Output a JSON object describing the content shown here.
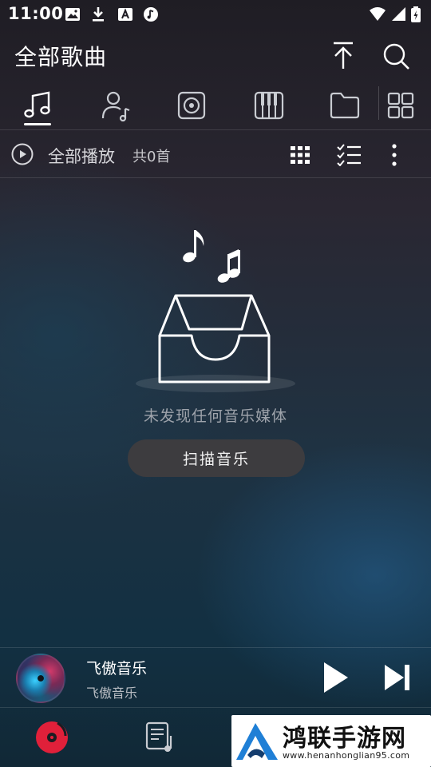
{
  "status_bar": {
    "time": "11:00"
  },
  "header": {
    "title": "全部歌曲"
  },
  "tabs": [
    {
      "name": "songs",
      "icon": "music-note-icon",
      "active": true
    },
    {
      "name": "artists",
      "icon": "artist-icon",
      "active": false
    },
    {
      "name": "albums",
      "icon": "disc-icon",
      "active": false
    },
    {
      "name": "genres",
      "icon": "piano-icon",
      "active": false
    },
    {
      "name": "folders",
      "icon": "folder-icon",
      "active": false
    },
    {
      "name": "more",
      "icon": "grid-icon",
      "active": false
    }
  ],
  "play_all": {
    "label": "全部播放",
    "count": "共0首"
  },
  "empty_state": {
    "message": "未发现任何音乐媒体",
    "scan_button": "扫描音乐"
  },
  "mini_player": {
    "title": "飞傲音乐",
    "artist": "飞傲音乐"
  },
  "watermark": {
    "title": "鸿联手游网",
    "url": "www.henanhonglian95.com"
  },
  "colors": {
    "accent": "#e0203a",
    "text_primary": "#ffffff",
    "text_secondary": "#9ea3ab",
    "button_bg": "#3d3c3f"
  }
}
